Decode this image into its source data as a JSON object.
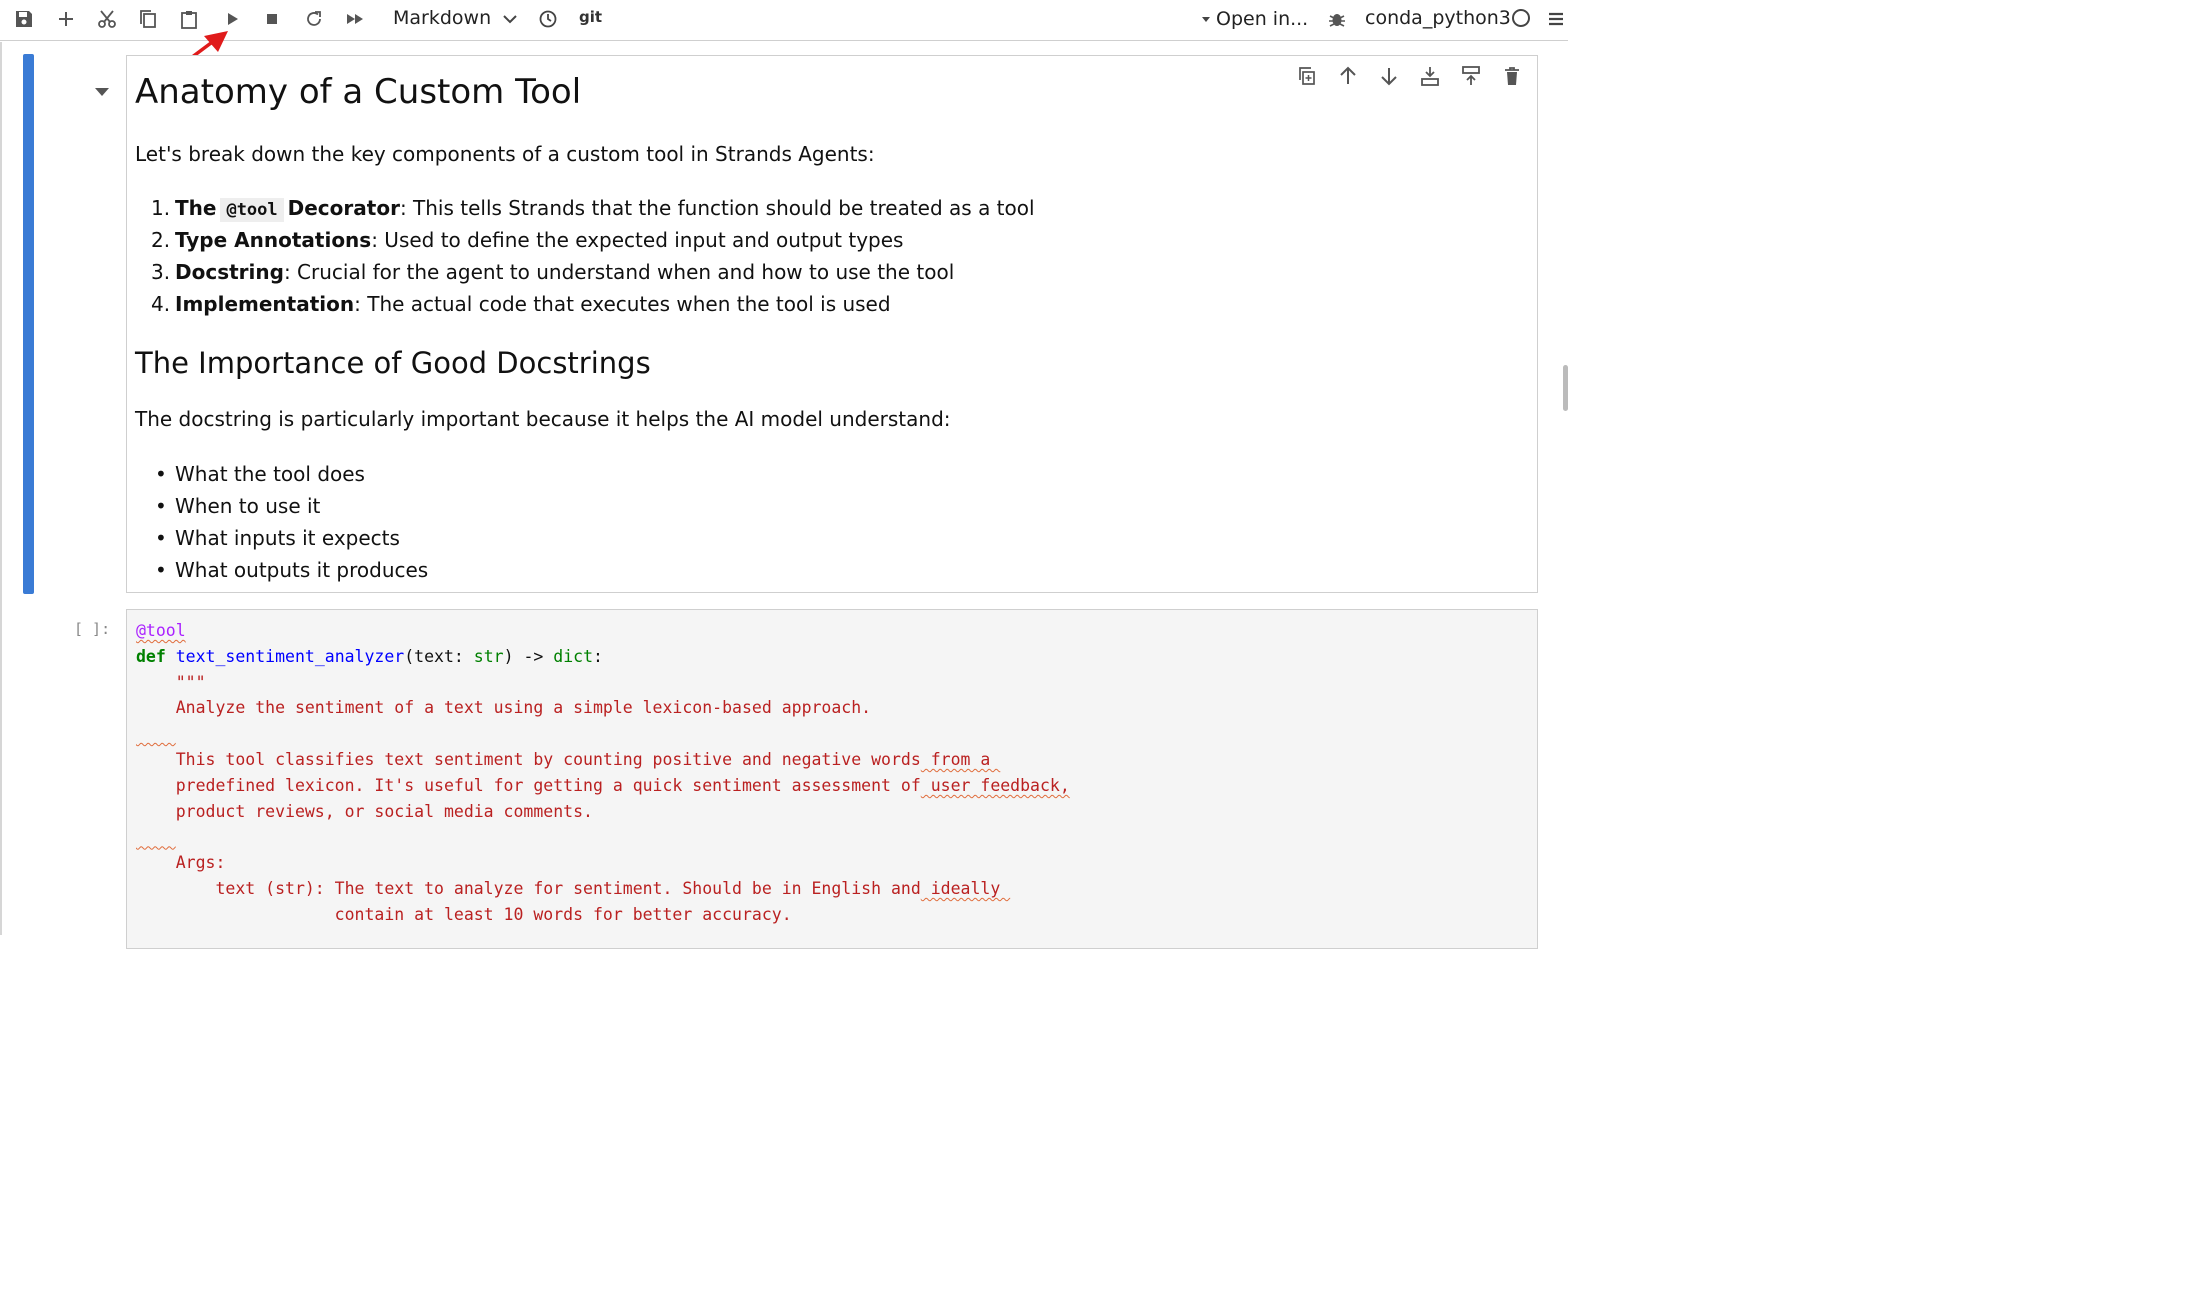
{
  "toolbar": {
    "cell_type": "Markdown",
    "git_label": "git",
    "open_in_label": "Open in...",
    "kernel_name": "conda_python3"
  },
  "markdown_cell": {
    "title": "Anatomy of a Custom Tool",
    "intro": "Let's break down the key components of a custom tool in Strands Agents:",
    "components": [
      {
        "num": "1.",
        "pre": "The",
        "code": "@tool",
        "bold": "Decorator",
        "text": ": This tells Strands that the function should be treated as a tool"
      },
      {
        "num": "2.",
        "bold": "Type Annotations",
        "text": ": Used to define the expected input and output types"
      },
      {
        "num": "3.",
        "bold": "Docstring",
        "text": ": Crucial for the agent to understand when and how to use the tool"
      },
      {
        "num": "4.",
        "bold": "Implementation",
        "text": ": The actual code that executes when the tool is used"
      }
    ],
    "subtitle": "The Importance of Good Docstrings",
    "subintro": "The docstring is particularly important because it helps the AI model understand:",
    "bullets": [
      "What the tool does",
      "When to use it",
      "What inputs it expects",
      "What outputs it produces"
    ]
  },
  "code_cell": {
    "prompt": "[ ]:",
    "decorator": "@tool",
    "def_kw": "def",
    "fn_name": "text_sentiment_analyzer",
    "sig_open": "(text: ",
    "type_str": "str",
    "sig_mid": ") -> ",
    "type_dict": "dict",
    "sig_end": ":",
    "doc_open": "    \"\"\"",
    "doc_line1": "    Analyze the sentiment of a text using a simple lexicon-based approach.",
    "doc_line2a": "    This tool classifies text sentiment by counting positive and negative words",
    "doc_line2b": " from a ",
    "doc_line3a": "    predefined lexicon. It's useful for getting a quick sentiment assessment of",
    "doc_line3b": " user feedback,",
    "doc_line4": "    product reviews, or social media comments.",
    "doc_args": "    Args:",
    "doc_arg1a": "        text (str): The text to analyze for sentiment. Should be in English and",
    "doc_arg1b": " ideally ",
    "doc_arg2": "                    contain at least 10 words for better accuracy."
  }
}
